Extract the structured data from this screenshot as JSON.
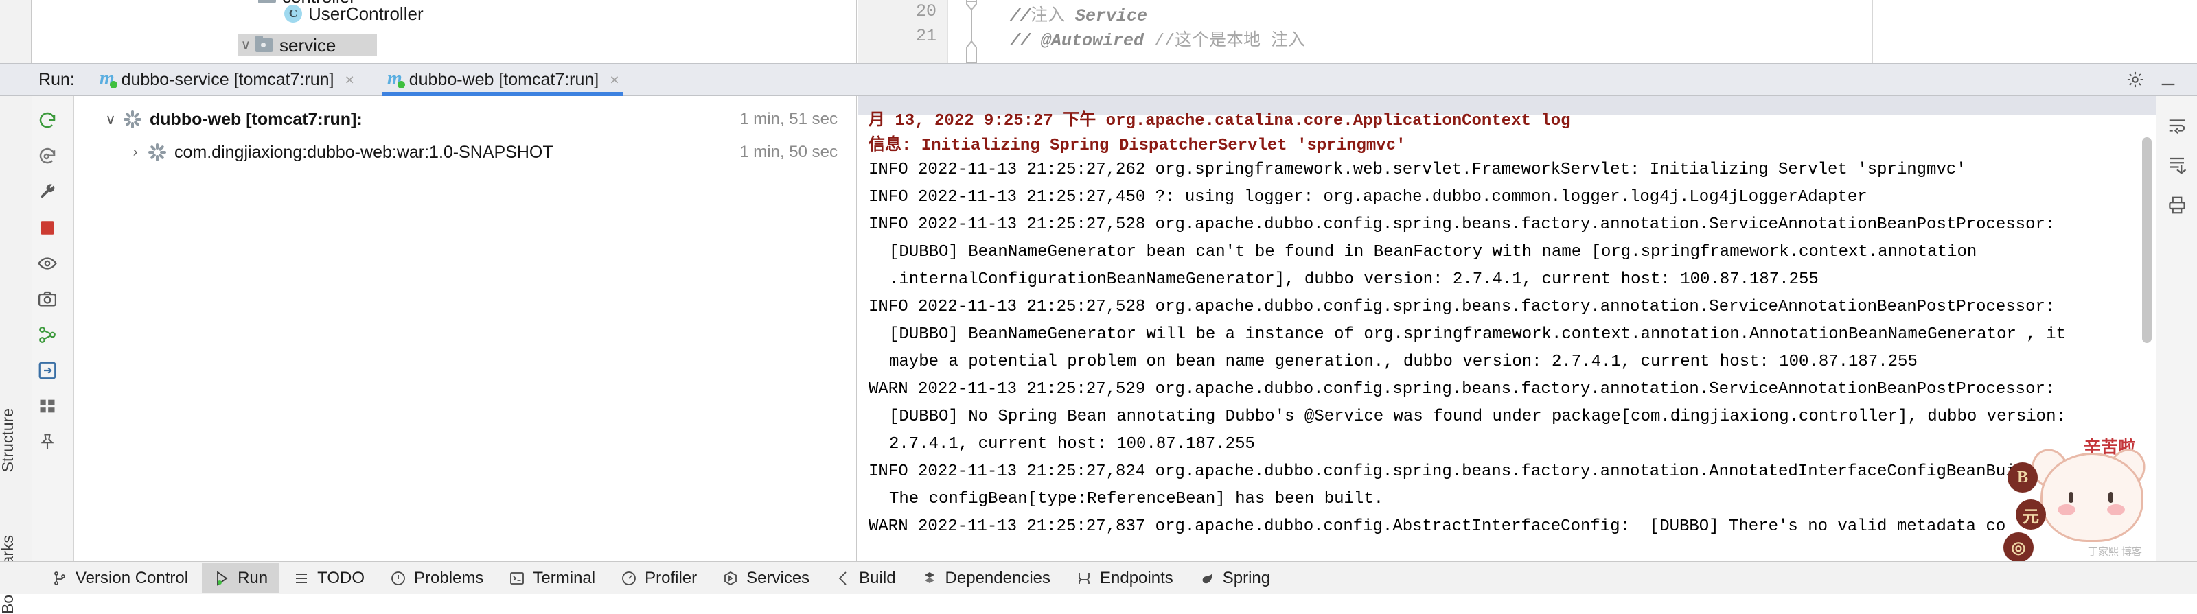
{
  "editor": {
    "lines": [
      {
        "no": "20",
        "comment_slashes": "//",
        "cn": "注入",
        "code": " Service",
        "tail": ""
      },
      {
        "no": "21",
        "comment_slashes": "//",
        "cn": "",
        "code": "    @Autowired ",
        "tail": "//这个是本地 注入"
      }
    ]
  },
  "project_tree": {
    "items": [
      {
        "label": "controller",
        "icon": "package-icon",
        "indent": 0
      },
      {
        "label": "UserController",
        "icon": "java-class-icon",
        "indent": 1
      },
      {
        "label": "service",
        "icon": "package-icon",
        "indent": 0,
        "selected": true
      }
    ]
  },
  "run_toolwindow": {
    "title": "Run:",
    "tabs": [
      {
        "label": "dubbo-service [tomcat7:run]",
        "icon": "maven-run-icon",
        "close": "×",
        "active": false
      },
      {
        "label": "dubbo-web [tomcat7:run]",
        "icon": "maven-run-icon",
        "close": "×",
        "active": true
      }
    ],
    "header_buttons": [
      {
        "name": "settings-icon"
      },
      {
        "name": "minimize-icon"
      }
    ],
    "left_rail_buttons": [
      {
        "name": "rerun-icon"
      },
      {
        "name": "debug-rerun-icon"
      },
      {
        "name": "wrench-icon"
      },
      {
        "name": "stop-icon"
      },
      {
        "name": "eye-icon"
      },
      {
        "name": "camera-icon"
      },
      {
        "name": "dependency-analyzer-icon"
      },
      {
        "name": "export-icon"
      },
      {
        "name": "grid-icon"
      },
      {
        "name": "pin-icon"
      }
    ],
    "right_rail_buttons": [
      {
        "name": "wrap-text-icon"
      },
      {
        "name": "scroll-end-icon"
      },
      {
        "name": "print-icon"
      }
    ],
    "tree": [
      {
        "label": "dubbo-web [tomcat7:run]:",
        "time": "1 min, 51 sec",
        "bold": true,
        "chevron": "∨",
        "indent": 0
      },
      {
        "label": "com.dingjiaxiong:dubbo-web:war:1.0-SNAPSHOT",
        "time": "1 min, 50 sec",
        "bold": false,
        "chevron": "›",
        "indent": 1
      }
    ]
  },
  "console": {
    "lines": [
      {
        "text": "月 13, 2022 9:25:27 下午 org.apache.catalina.core.ApplicationContext log",
        "color": "red",
        "indent": 0
      },
      {
        "text": "信息: Initializing Spring DispatcherServlet 'springmvc'",
        "color": "red",
        "indent": 0
      },
      {
        "text": "INFO 2022-11-13 21:25:27,262 org.springframework.web.servlet.FrameworkServlet: Initializing Servlet 'springmvc'",
        "color": "black",
        "indent": 0
      },
      {
        "text": "INFO 2022-11-13 21:25:27,450 ?: using logger: org.apache.dubbo.common.logger.log4j.Log4jLoggerAdapter",
        "color": "black",
        "indent": 0
      },
      {
        "text": "INFO 2022-11-13 21:25:27,528 org.apache.dubbo.config.spring.beans.factory.annotation.ServiceAnnotationBeanPostProcessor:",
        "color": "black",
        "indent": 0
      },
      {
        "text": "[DUBBO] BeanNameGenerator bean can't be found in BeanFactory with name [org.springframework.context.annotation",
        "color": "black",
        "indent": 1
      },
      {
        "text": ".internalConfigurationBeanNameGenerator], dubbo version: 2.7.4.1, current host: 100.87.187.255",
        "color": "black",
        "indent": 1
      },
      {
        "text": "INFO 2022-11-13 21:25:27,528 org.apache.dubbo.config.spring.beans.factory.annotation.ServiceAnnotationBeanPostProcessor:",
        "color": "black",
        "indent": 0
      },
      {
        "text": "[DUBBO] BeanNameGenerator will be a instance of org.springframework.context.annotation.AnnotationBeanNameGenerator , it",
        "color": "black",
        "indent": 1
      },
      {
        "text": "maybe a potential problem on bean name generation., dubbo version: 2.7.4.1, current host: 100.87.187.255",
        "color": "black",
        "indent": 1
      },
      {
        "text": "WARN 2022-11-13 21:25:27,529 org.apache.dubbo.config.spring.beans.factory.annotation.ServiceAnnotationBeanPostProcessor:",
        "color": "black",
        "indent": 0
      },
      {
        "text": "[DUBBO] No Spring Bean annotating Dubbo's @Service was found under package[com.dingjiaxiong.controller], dubbo version:",
        "color": "black",
        "indent": 1
      },
      {
        "text": "2.7.4.1, current host: 100.87.187.255",
        "color": "black",
        "indent": 1
      },
      {
        "text": "INFO 2022-11-13 21:25:27,824 org.apache.dubbo.config.spring.beans.factory.annotation.AnnotatedInterfaceConfigBeanBuilder:",
        "color": "black",
        "indent": 0
      },
      {
        "text": "The configBean[type:ReferenceBean] has been built.",
        "color": "black",
        "indent": 1
      },
      {
        "text": "WARN 2022-11-13 21:25:27,837 org.apache.dubbo.config.AbstractInterfaceConfig:  [DUBBO] There's no valid metadata co",
        "color": "black",
        "indent": 0
      }
    ]
  },
  "watermark": {
    "text": "辛苦啦",
    "subtext": "丁家熙 博客",
    "coins": [
      "B",
      "元",
      "◎"
    ]
  },
  "statusbar": {
    "items": [
      {
        "label": "Version Control",
        "icon": "branch-icon",
        "active": false
      },
      {
        "label": "Run",
        "icon": "run-icon",
        "active": true
      },
      {
        "label": "TODO",
        "icon": "todo-icon",
        "active": false
      },
      {
        "label": "Problems",
        "icon": "problems-icon",
        "active": false
      },
      {
        "label": "Terminal",
        "icon": "terminal-icon",
        "active": false
      },
      {
        "label": "Profiler",
        "icon": "profiler-icon",
        "active": false
      },
      {
        "label": "Services",
        "icon": "services-icon",
        "active": false
      },
      {
        "label": "Build",
        "icon": "build-icon",
        "active": false
      },
      {
        "label": "Dependencies",
        "icon": "dependencies-icon",
        "active": false
      },
      {
        "label": "Endpoints",
        "icon": "endpoints-icon",
        "active": false
      },
      {
        "label": "Spring",
        "icon": "spring-icon",
        "active": false
      }
    ]
  },
  "vertical_labels": {
    "structure": "Structure",
    "bookmarks": "Bookmarks"
  }
}
